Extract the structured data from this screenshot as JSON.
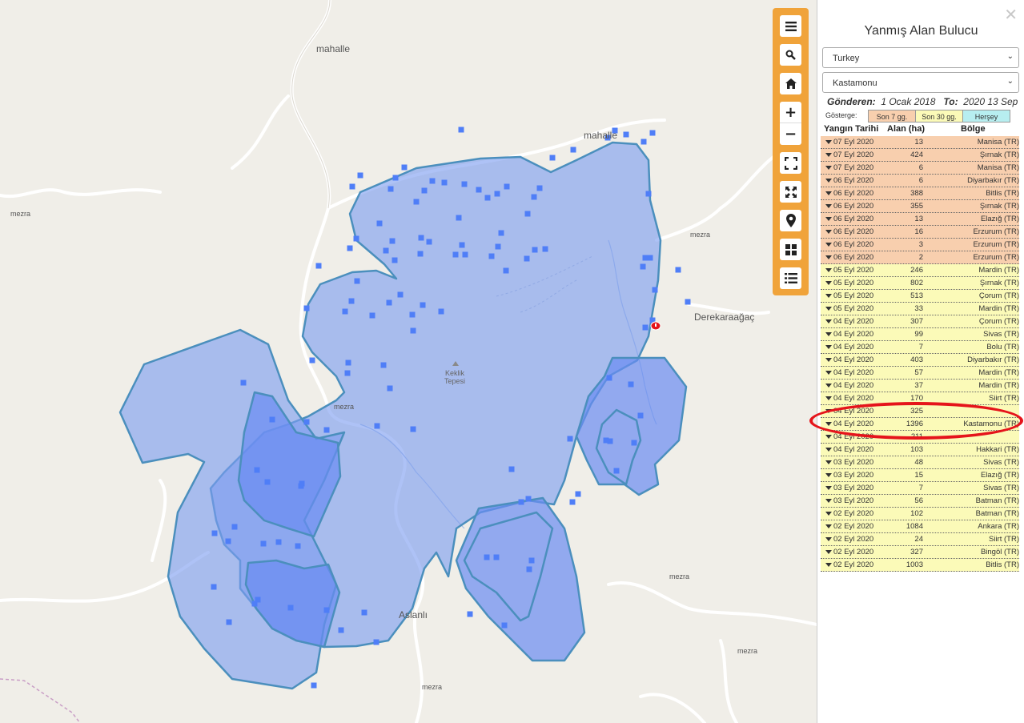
{
  "map": {
    "labels": [
      {
        "id": "mahalle-1",
        "text": "mahalle"
      },
      {
        "id": "mahalle-2",
        "text": "mahalle"
      },
      {
        "id": "mezra-1",
        "text": "mezra"
      },
      {
        "id": "mezra-2",
        "text": "mezra"
      },
      {
        "id": "mezra-3",
        "text": "mezra"
      },
      {
        "id": "mezra-4",
        "text": "mezra"
      },
      {
        "id": "mezra-5",
        "text": "mezra"
      },
      {
        "id": "mezra-6",
        "text": "mezra"
      },
      {
        "id": "derekaraagac",
        "text": "Derekaraağaç"
      },
      {
        "id": "aslanli",
        "text": "Aslanlı"
      },
      {
        "id": "keklik-1",
        "text": "Keklik"
      },
      {
        "id": "keklik-2",
        "text": "Tepesi"
      }
    ],
    "burn_color": "#7d9cf0",
    "burn_outline": "#4b8fbd",
    "hotspot_color": "#4f7ef7"
  },
  "toolbar": {
    "color": "#f0a33a",
    "buttons": [
      "menu-icon",
      "search-icon",
      "home-icon",
      "zoom-in-icon",
      "zoom-out-icon",
      "fullscreen-icon",
      "fit-extent-icon",
      "location-pin-icon",
      "grid-icon",
      "list-icon"
    ],
    "zoom_in": "+",
    "zoom_out": "−"
  },
  "panel": {
    "close": "✕",
    "title": "Yanmış Alan Bulucu",
    "country": "Turkey",
    "province": "Kastamonu",
    "from_label": "Gönderen:",
    "from_value": "1 Ocak 2018",
    "to_label": "To:",
    "to_value": "2020 13 Sep",
    "legend_label": "Gösterge:",
    "legend": [
      {
        "label": "Son 7 gg.",
        "color": "#f8cfae"
      },
      {
        "label": "Son 30 gg.",
        "color": "#fbfab8"
      },
      {
        "label": "Herşey",
        "color": "#b7eef0"
      }
    ],
    "columns": {
      "date": "Yangın Tarihi",
      "area": "Alan (ha)",
      "region": "Bölge"
    },
    "rows": [
      {
        "date": "07 Eyl 2020",
        "area": "13",
        "region": "Manisa (TR)",
        "cat": "recent"
      },
      {
        "date": "07 Eyl 2020",
        "area": "424",
        "region": "Şırnak (TR)",
        "cat": "recent"
      },
      {
        "date": "07 Eyl 2020",
        "area": "6",
        "region": "Manisa (TR)",
        "cat": "recent"
      },
      {
        "date": "06 Eyl 2020",
        "area": "6",
        "region": "Diyarbakır (TR)",
        "cat": "recent"
      },
      {
        "date": "06 Eyl 2020",
        "area": "388",
        "region": "Bitlis (TR)",
        "cat": "recent"
      },
      {
        "date": "06 Eyl 2020",
        "area": "355",
        "region": "Şırnak (TR)",
        "cat": "recent"
      },
      {
        "date": "06 Eyl 2020",
        "area": "13",
        "region": "Elazığ (TR)",
        "cat": "recent"
      },
      {
        "date": "06 Eyl 2020",
        "area": "16",
        "region": "Erzurum (TR)",
        "cat": "recent"
      },
      {
        "date": "06 Eyl 2020",
        "area": "3",
        "region": "Erzurum (TR)",
        "cat": "recent"
      },
      {
        "date": "06 Eyl 2020",
        "area": "2",
        "region": "Erzurum (TR)",
        "cat": "recent"
      },
      {
        "date": "05 Eyl 2020",
        "area": "246",
        "region": "Mardin (TR)",
        "cat": "month"
      },
      {
        "date": "05 Eyl 2020",
        "area": "802",
        "region": "Şırnak (TR)",
        "cat": "month"
      },
      {
        "date": "05 Eyl 2020",
        "area": "513",
        "region": "Çorum (TR)",
        "cat": "month"
      },
      {
        "date": "05 Eyl 2020",
        "area": "33",
        "region": "Mardin (TR)",
        "cat": "month"
      },
      {
        "date": "04 Eyl 2020",
        "area": "307",
        "region": "Çorum (TR)",
        "cat": "month"
      },
      {
        "date": "04 Eyl 2020",
        "area": "99",
        "region": "Sivas (TR)",
        "cat": "month"
      },
      {
        "date": "04 Eyl 2020",
        "area": "7",
        "region": "Bolu (TR)",
        "cat": "month"
      },
      {
        "date": "04 Eyl 2020",
        "area": "403",
        "region": "Diyarbakır (TR)",
        "cat": "month"
      },
      {
        "date": "04 Eyl 2020",
        "area": "57",
        "region": "Mardin (TR)",
        "cat": "month"
      },
      {
        "date": "04 Eyl 2020",
        "area": "37",
        "region": "Mardin (TR)",
        "cat": "month"
      },
      {
        "date": "04 Eyl 2020",
        "area": "170",
        "region": "Siirt (TR)",
        "cat": "month"
      },
      {
        "date": "04 Eyl 2020",
        "area": "325",
        "region": "",
        "cat": "month"
      },
      {
        "date": "04 Eyl 2020",
        "area": "1396",
        "region": "Kastamonu (TR)",
        "cat": "month"
      },
      {
        "date": "04 Eyl 2020",
        "area": "211",
        "region": "",
        "cat": "month"
      },
      {
        "date": "04 Eyl 2020",
        "area": "103",
        "region": "Hakkari (TR)",
        "cat": "month"
      },
      {
        "date": "03 Eyl 2020",
        "area": "48",
        "region": "Sivas (TR)",
        "cat": "month"
      },
      {
        "date": "03 Eyl 2020",
        "area": "15",
        "region": "Elazığ (TR)",
        "cat": "month"
      },
      {
        "date": "03 Eyl 2020",
        "area": "7",
        "region": "Sivas (TR)",
        "cat": "month"
      },
      {
        "date": "03 Eyl 2020",
        "area": "56",
        "region": "Batman (TR)",
        "cat": "month"
      },
      {
        "date": "02 Eyl 2020",
        "area": "102",
        "region": "Batman (TR)",
        "cat": "month"
      },
      {
        "date": "02 Eyl 2020",
        "area": "1084",
        "region": "Ankara (TR)",
        "cat": "month"
      },
      {
        "date": "02 Eyl 2020",
        "area": "24",
        "region": "Siirt (TR)",
        "cat": "month"
      },
      {
        "date": "02 Eyl 2020",
        "area": "327",
        "region": "Bingöl (TR)",
        "cat": "month"
      },
      {
        "date": "02 Eyl 2020",
        "area": "1003",
        "region": "Bitlis (TR)",
        "cat": "month"
      }
    ],
    "highlight_color": "#e5141b"
  }
}
